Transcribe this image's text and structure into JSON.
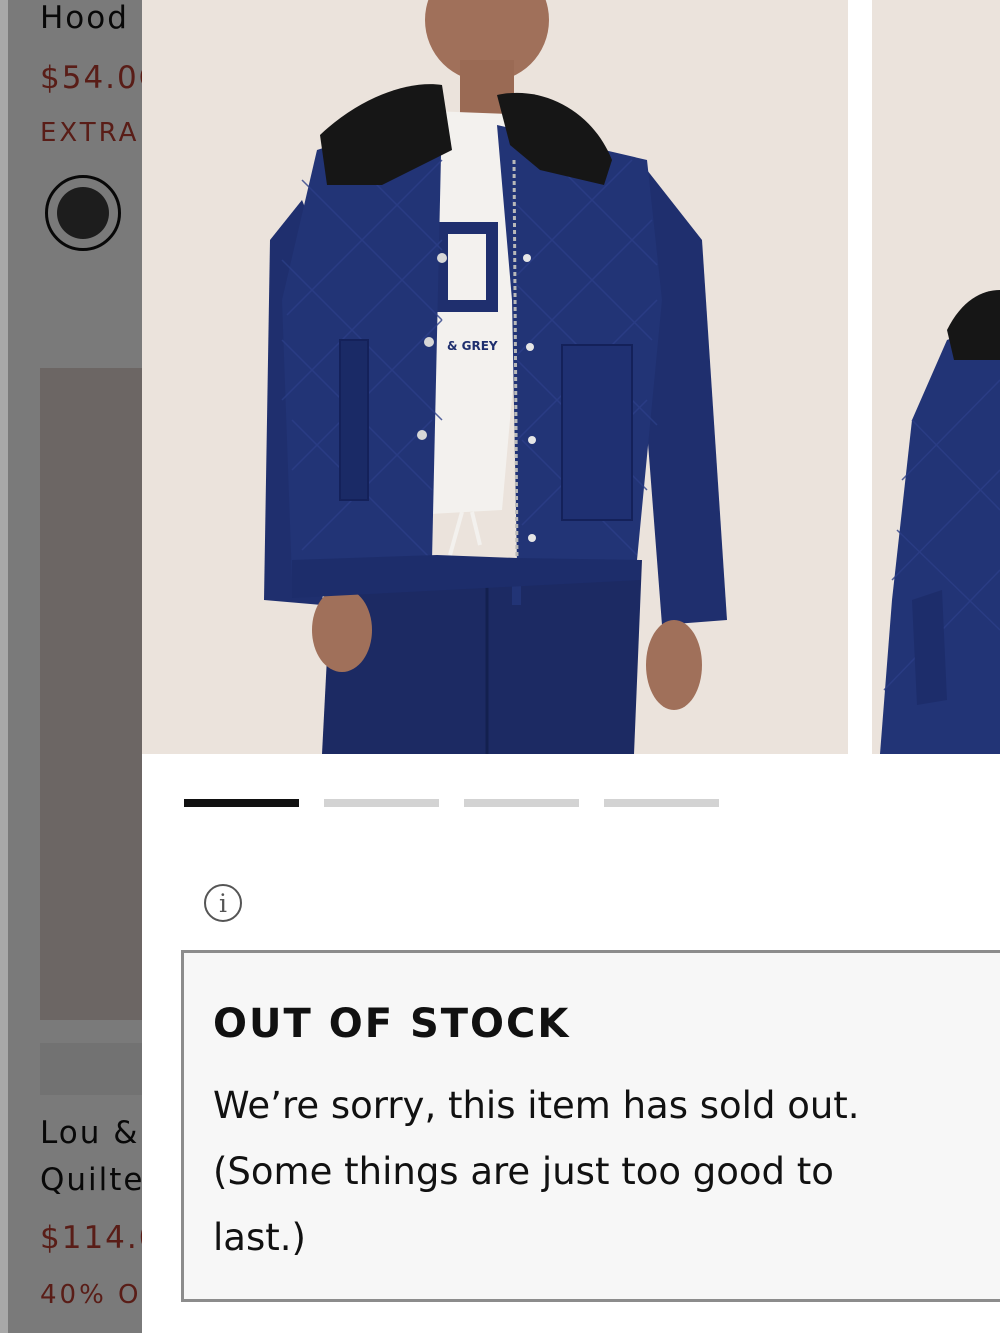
{
  "background_grid": {
    "item1_name": "Hood",
    "item1_price": "$54.0C",
    "item1_promo": "EXTRA",
    "item2_name_line1": "Lou &",
    "item2_name_line2": "Quilte",
    "item2_price": "$114.0C",
    "item2_promo": "40% OF"
  },
  "modal": {
    "images": {
      "current_alt": "quilted-navy-jacket-front",
      "next_alt": "quilted-navy-jacket-side",
      "shirt_print": "& GREY"
    },
    "pager": {
      "total": 4,
      "active_index": 0
    },
    "notice": {
      "icon": "info-icon",
      "title": "OUT OF STOCK",
      "message": "We’re sorry, this item has sold out. (Some things are just too good to last.)"
    }
  },
  "colors": {
    "sale_red": "#b23a2f",
    "jacket_navy": "#1f2f6e",
    "photo_background": "#ebe3dc"
  }
}
